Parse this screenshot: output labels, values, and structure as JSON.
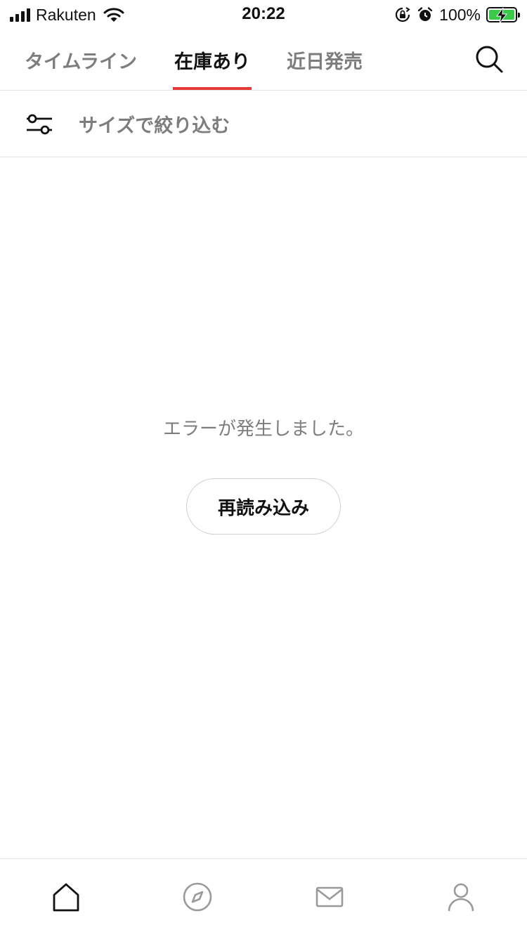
{
  "status_bar": {
    "carrier": "Rakuten",
    "time": "20:22",
    "battery_percent": "100%",
    "battery_level": 1.0,
    "icons": [
      "signal-icon",
      "wifi-icon",
      "orientation-lock-icon",
      "alarm-icon",
      "battery-charging-icon"
    ]
  },
  "tabs": [
    {
      "label": "タイムライン",
      "active": false
    },
    {
      "label": "在庫あり",
      "active": true
    },
    {
      "label": "近日発売",
      "active": false
    }
  ],
  "header": {
    "search_icon": "search-icon"
  },
  "filter": {
    "label": "サイズで絞り込む",
    "icon": "sliders-icon"
  },
  "error": {
    "message": "エラーが発生しました。",
    "reload_label": "再読み込み"
  },
  "bottom_nav": {
    "items": [
      {
        "icon": "home-icon",
        "active": true
      },
      {
        "icon": "compass-icon",
        "active": false
      },
      {
        "icon": "mail-icon",
        "active": false
      },
      {
        "icon": "profile-icon",
        "active": false
      }
    ]
  },
  "colors": {
    "accent": "#e53935",
    "active_text": "#111111",
    "inactive_text": "#7d7d7d",
    "divider": "#e2e2e2",
    "battery": "#3cc94a"
  }
}
